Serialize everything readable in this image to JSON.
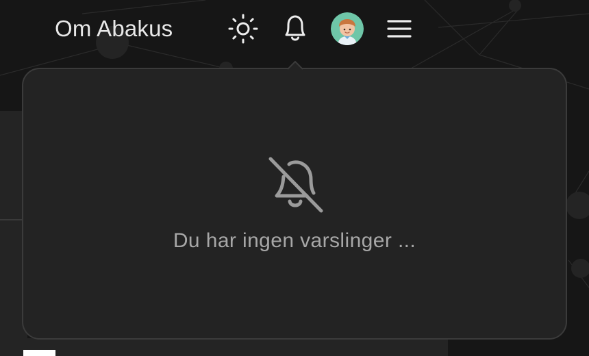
{
  "header": {
    "nav_link_label": "Om Abakus",
    "icons": {
      "theme": "sun-icon",
      "notifications": "bell-icon",
      "profile": "avatar",
      "menu": "hamburger-menu-icon"
    }
  },
  "notifications_popover": {
    "empty_icon": "bell-off-icon",
    "empty_message": "Du har ingen varslinger ..."
  },
  "colors": {
    "background": "#161616",
    "popover": "#232323",
    "popover_border": "#3b3b3b",
    "text_primary": "#e8e8e8",
    "text_muted": "#a7a7a7"
  }
}
